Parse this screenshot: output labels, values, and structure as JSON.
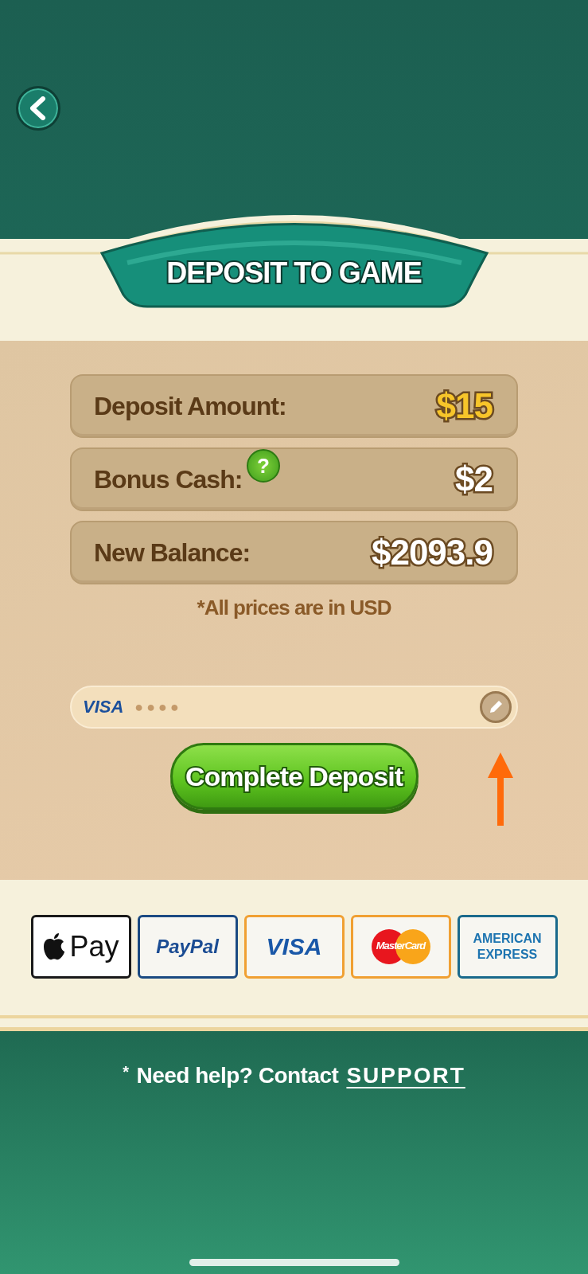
{
  "header": {
    "title": "DEPOSIT TO GAME"
  },
  "summary": [
    {
      "label": "Deposit Amount:",
      "value": "$15",
      "kind": "gold",
      "help": false
    },
    {
      "label": "Bonus Cash:",
      "value": "$2",
      "kind": "white",
      "help": true,
      "help_mark": "?"
    },
    {
      "label": "New Balance:",
      "value": "$2093.9",
      "kind": "white",
      "help": false
    }
  ],
  "note": "*All prices are in USD",
  "card": {
    "brand": "VISA",
    "mask": "●●●●"
  },
  "submit": {
    "label": "Complete Deposit"
  },
  "payment_methods": [
    {
      "kind": "applepay",
      "text": "Pay"
    },
    {
      "kind": "paypal",
      "text": "PayPal"
    },
    {
      "kind": "visa",
      "text": "VISA"
    },
    {
      "kind": "mastercard",
      "text": "MasterCard"
    },
    {
      "kind": "amex",
      "text": "AMERICAN EXPRESS"
    }
  ],
  "help": {
    "mark": "*",
    "text": "Need help? Contact",
    "link": "SUPPORT"
  }
}
